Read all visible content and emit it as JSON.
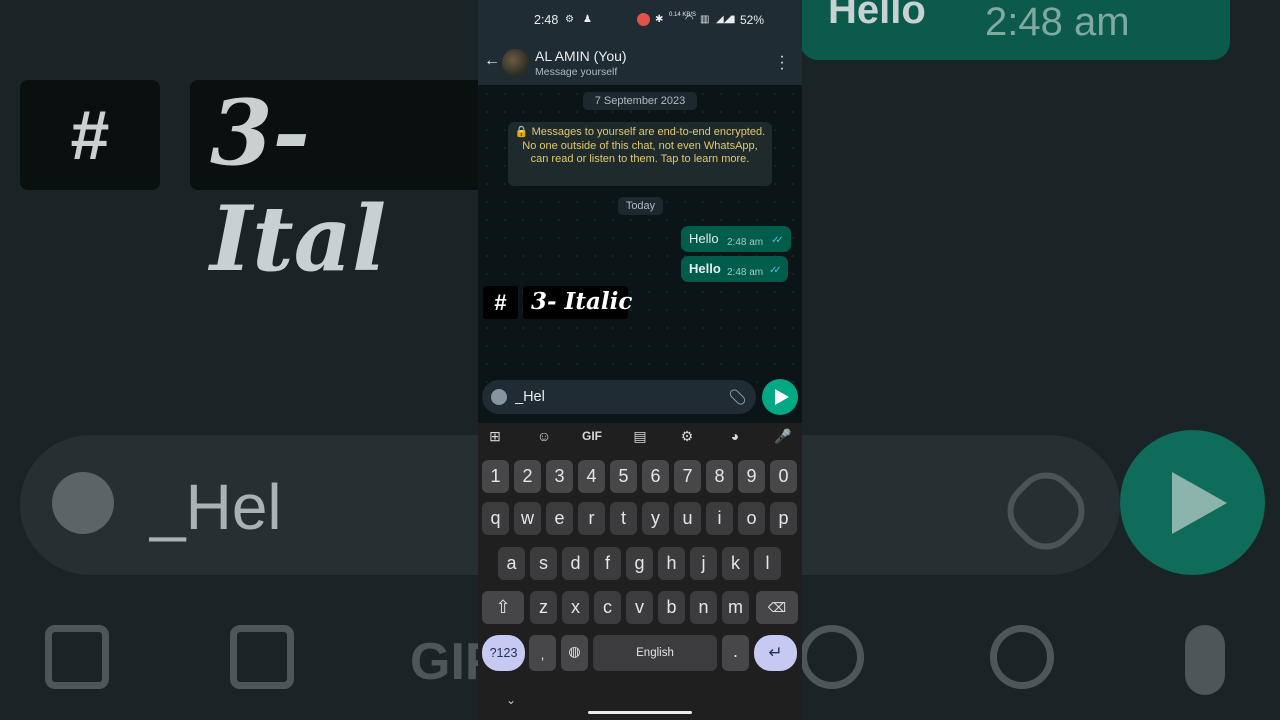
{
  "status_bar": {
    "time": "2:48",
    "battery": "52%",
    "net_speed": "0.14\nKB/S"
  },
  "header": {
    "name": "AL AMIN (You)",
    "subtitle": "Message yourself"
  },
  "chat": {
    "date_label": "7 September 2023",
    "encryption_notice": "🔒 Messages to yourself are end-to-end encrypted. No one outside of this chat, not even WhatsApp, can read or listen to them. Tap to learn more.",
    "today_label": "Today",
    "messages": [
      {
        "text": "Hello",
        "time": "2:48 am",
        "bold": false
      },
      {
        "text": "Hello",
        "time": "2:48 am",
        "bold": true
      }
    ]
  },
  "overlay": {
    "hash": "#",
    "title": "3- Italic"
  },
  "input": {
    "value": "_Hel"
  },
  "keyboard": {
    "row_numbers": [
      "1",
      "2",
      "3",
      "4",
      "5",
      "6",
      "7",
      "8",
      "9",
      "0"
    ],
    "row_1": [
      "q",
      "w",
      "e",
      "r",
      "t",
      "y",
      "u",
      "i",
      "o",
      "p"
    ],
    "row_2": [
      "a",
      "s",
      "d",
      "f",
      "g",
      "h",
      "j",
      "k",
      "l"
    ],
    "row_3": [
      "z",
      "x",
      "c",
      "v",
      "b",
      "n",
      "m"
    ],
    "mode_key": "?123",
    "comma_key": ",",
    "space_label": "English",
    "period_key": "."
  },
  "background": {
    "hello": "Hello",
    "hello_time": "2:48 am",
    "hash": "#",
    "title": "3- Ital",
    "input": "_Hel",
    "gif": "GIF"
  },
  "colors": {
    "accent": "#00a884",
    "outgoing_bubble": "#005c4b",
    "tick_read": "#53bdeb"
  }
}
